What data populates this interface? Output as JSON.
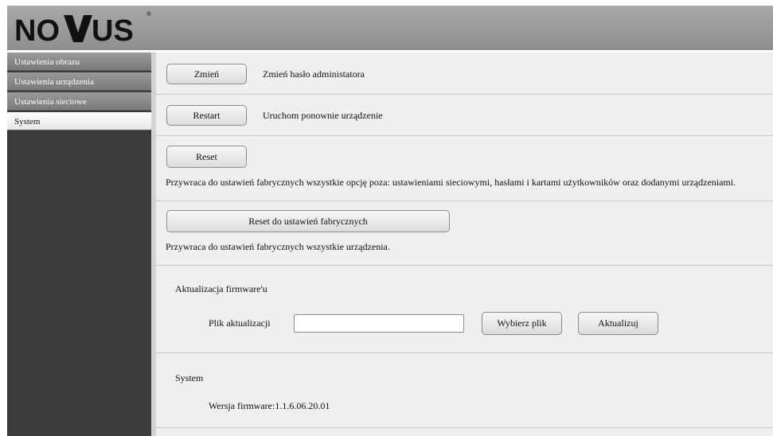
{
  "header": {
    "logo_text": "NOVUS",
    "logo_mark": "®"
  },
  "sidebar": {
    "items": [
      {
        "label": "Ustawienia obrazu",
        "active": false
      },
      {
        "label": "Ustawienia urządzenia",
        "active": false
      },
      {
        "label": "Ustawienia sieciowe",
        "active": false
      },
      {
        "label": "System",
        "active": true
      }
    ]
  },
  "main": {
    "change_password": {
      "button": "Zmień",
      "description": "Zmień hasło administatora"
    },
    "restart": {
      "button": "Restart",
      "description": "Uruchom ponownie urządzenie"
    },
    "reset": {
      "button": "Reset",
      "description": "Przywraca do ustawień fabrycznych wszystkie opcję poza: ustawieniami sieciowymi, hasłami i kartami użytkowników oraz dodanymi urządzeniami."
    },
    "factory_reset": {
      "button": "Reset do ustawień fabrycznych",
      "description": "Przywraca do ustawień fabrycznych wszystkie urządzenia."
    },
    "firmware_update": {
      "title": "Aktualizacja firmware'u",
      "file_label": "Plik aktualizacji",
      "file_value": "",
      "choose_button": "Wybierz plik",
      "update_button": "Aktualizuj"
    },
    "system": {
      "title": "System",
      "firmware_version": "Wersja firmware:1.1.6.06.20.01"
    }
  }
}
